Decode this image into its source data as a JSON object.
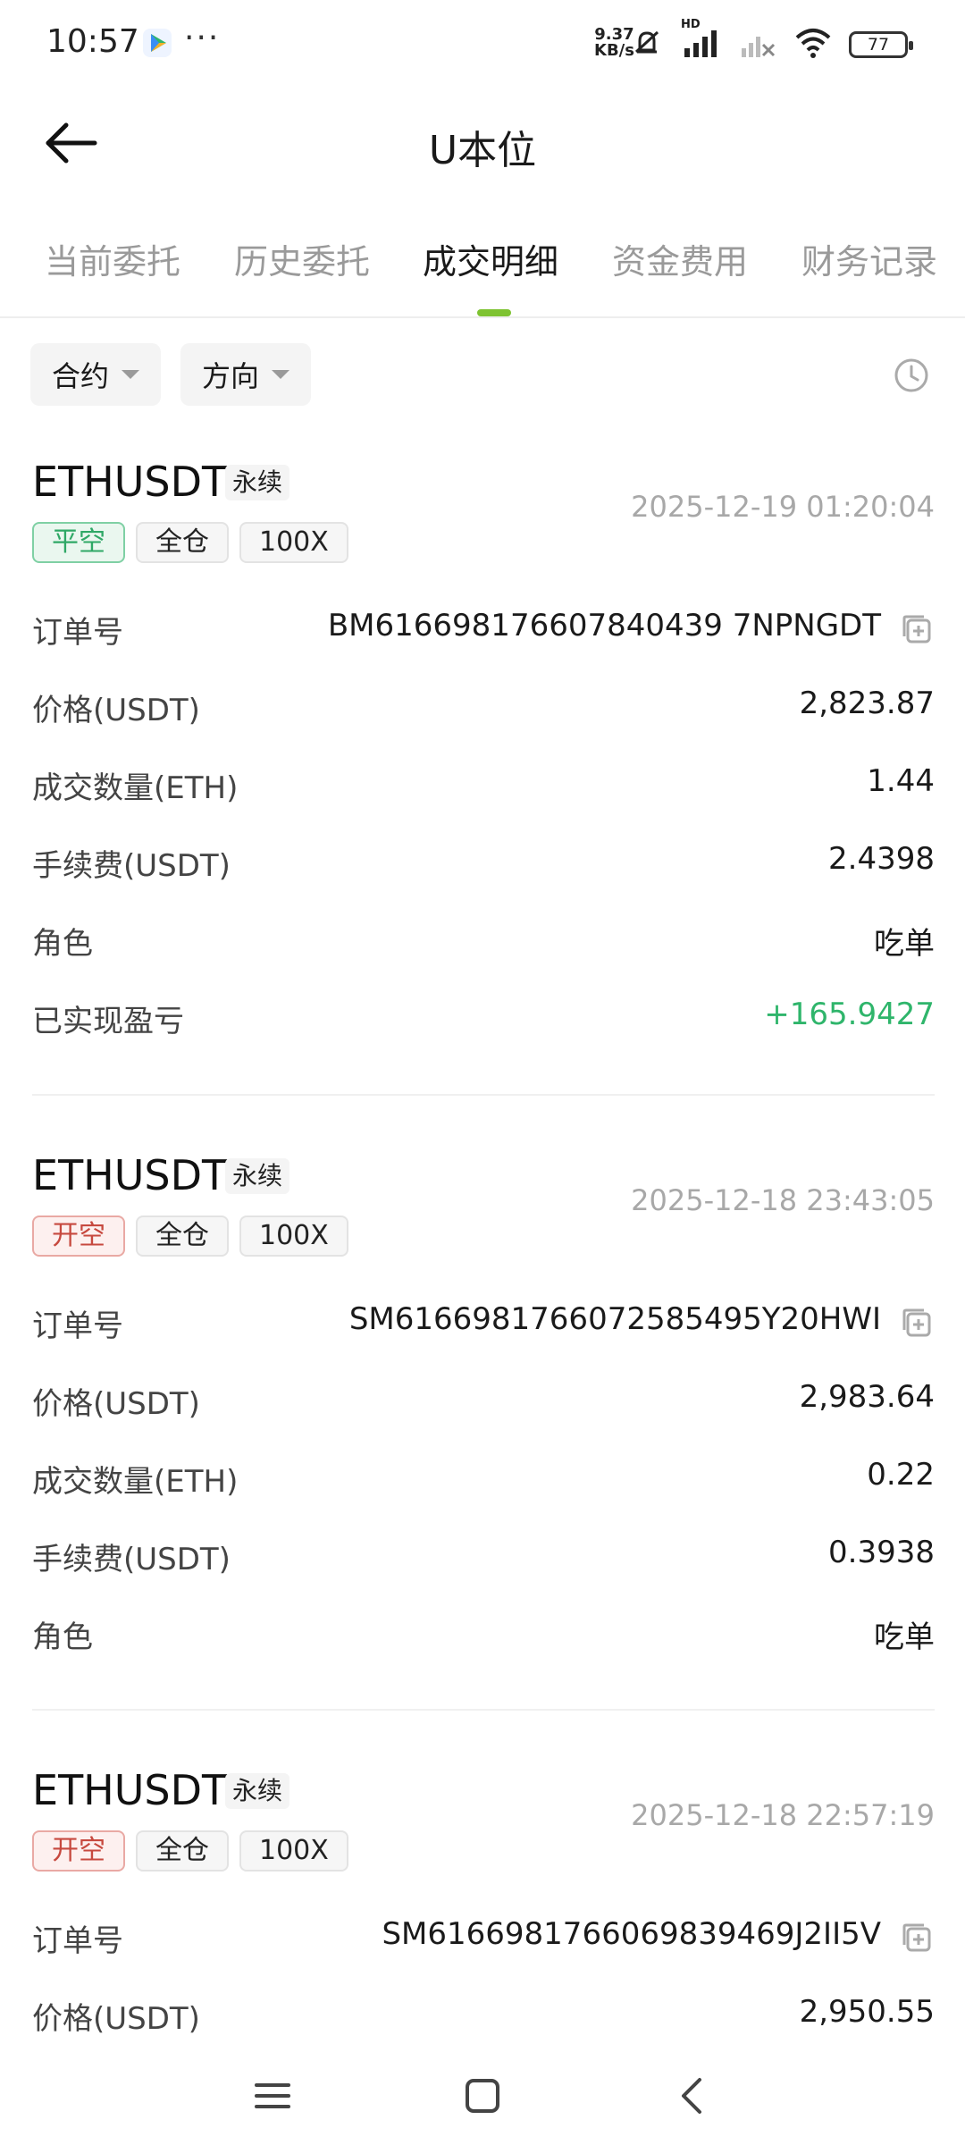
{
  "status_bar": {
    "time": "10:57",
    "speed_value": "9.37",
    "speed_unit": "KB/s",
    "network_label": "HD",
    "battery": "77",
    "icons": [
      "play-store-icon",
      "more-dots-icon",
      "mute-icon",
      "signal-icon",
      "signal-no-service-icon",
      "wifi-icon",
      "battery-icon"
    ]
  },
  "header": {
    "title": "U本位",
    "back_icon": "arrow-left-icon"
  },
  "tabs": [
    {
      "label": "当前委托",
      "active": false
    },
    {
      "label": "历史委托",
      "active": false
    },
    {
      "label": "成交明细",
      "active": true
    },
    {
      "label": "资金费用",
      "active": false
    },
    {
      "label": "财务记录",
      "active": false
    }
  ],
  "accent_color": "#7ec331",
  "filters": {
    "contract": "合约",
    "direction": "方向",
    "time_icon": "clock-icon"
  },
  "colors": {
    "profit": "#2fb56b",
    "close_short": "#2fa866",
    "open_short": "#c7493f"
  },
  "trades": [
    {
      "symbol": "ETHUSDT",
      "contract_type": "永续",
      "time": "2025-12-19 01:20:04",
      "side": "平空",
      "margin_mode": "全仓",
      "leverage": "100X",
      "order_no_label": "订单号",
      "order_no": "BM616698176607840439 7NPNGDT",
      "price_label": "价格(USDT)",
      "price": "2,823.87",
      "qty_label": "成交数量(ETH)",
      "qty": "1.44",
      "fee_label": "手续费(USDT)",
      "fee": "2.4398",
      "role_label": "角色",
      "role": "吃单",
      "pnl_label": "已实现盈亏",
      "pnl": "+165.9427"
    },
    {
      "symbol": "ETHUSDT",
      "contract_type": "永续",
      "time": "2025-12-18 23:43:05",
      "side": "开空",
      "margin_mode": "全仓",
      "leverage": "100X",
      "order_no_label": "订单号",
      "order_no": "SM6166981766072585495Y20HWI",
      "price_label": "价格(USDT)",
      "price": "2,983.64",
      "qty_label": "成交数量(ETH)",
      "qty": "0.22",
      "fee_label": "手续费(USDT)",
      "fee": "0.3938",
      "role_label": "角色",
      "role": "吃单"
    },
    {
      "symbol": "ETHUSDT",
      "contract_type": "永续",
      "time": "2025-12-18 22:57:19",
      "side": "开空",
      "margin_mode": "全仓",
      "leverage": "100X",
      "order_no_label": "订单号",
      "order_no": "SM6166981766069839469J2II5V",
      "price_label": "价格(USDT)",
      "price": "2,950.55"
    }
  ],
  "bottom_nav": {
    "icons": [
      "menu-icon",
      "home-square-icon",
      "back-chevron-icon"
    ]
  }
}
